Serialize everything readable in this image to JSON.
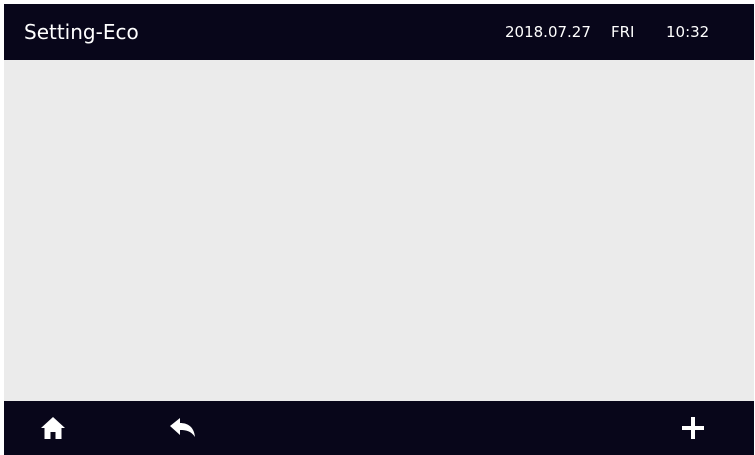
{
  "header": {
    "title": "Setting-Eco",
    "date": "2018.07.27",
    "day": "FRI",
    "time": "10:32"
  },
  "footer": {
    "home_icon": "home-icon",
    "back_icon": "back-arrow-icon",
    "add_icon": "plus-icon"
  },
  "colors": {
    "bar_background": "#08061a",
    "content_background": "#ebebeb",
    "icon_color": "#ffffff"
  }
}
